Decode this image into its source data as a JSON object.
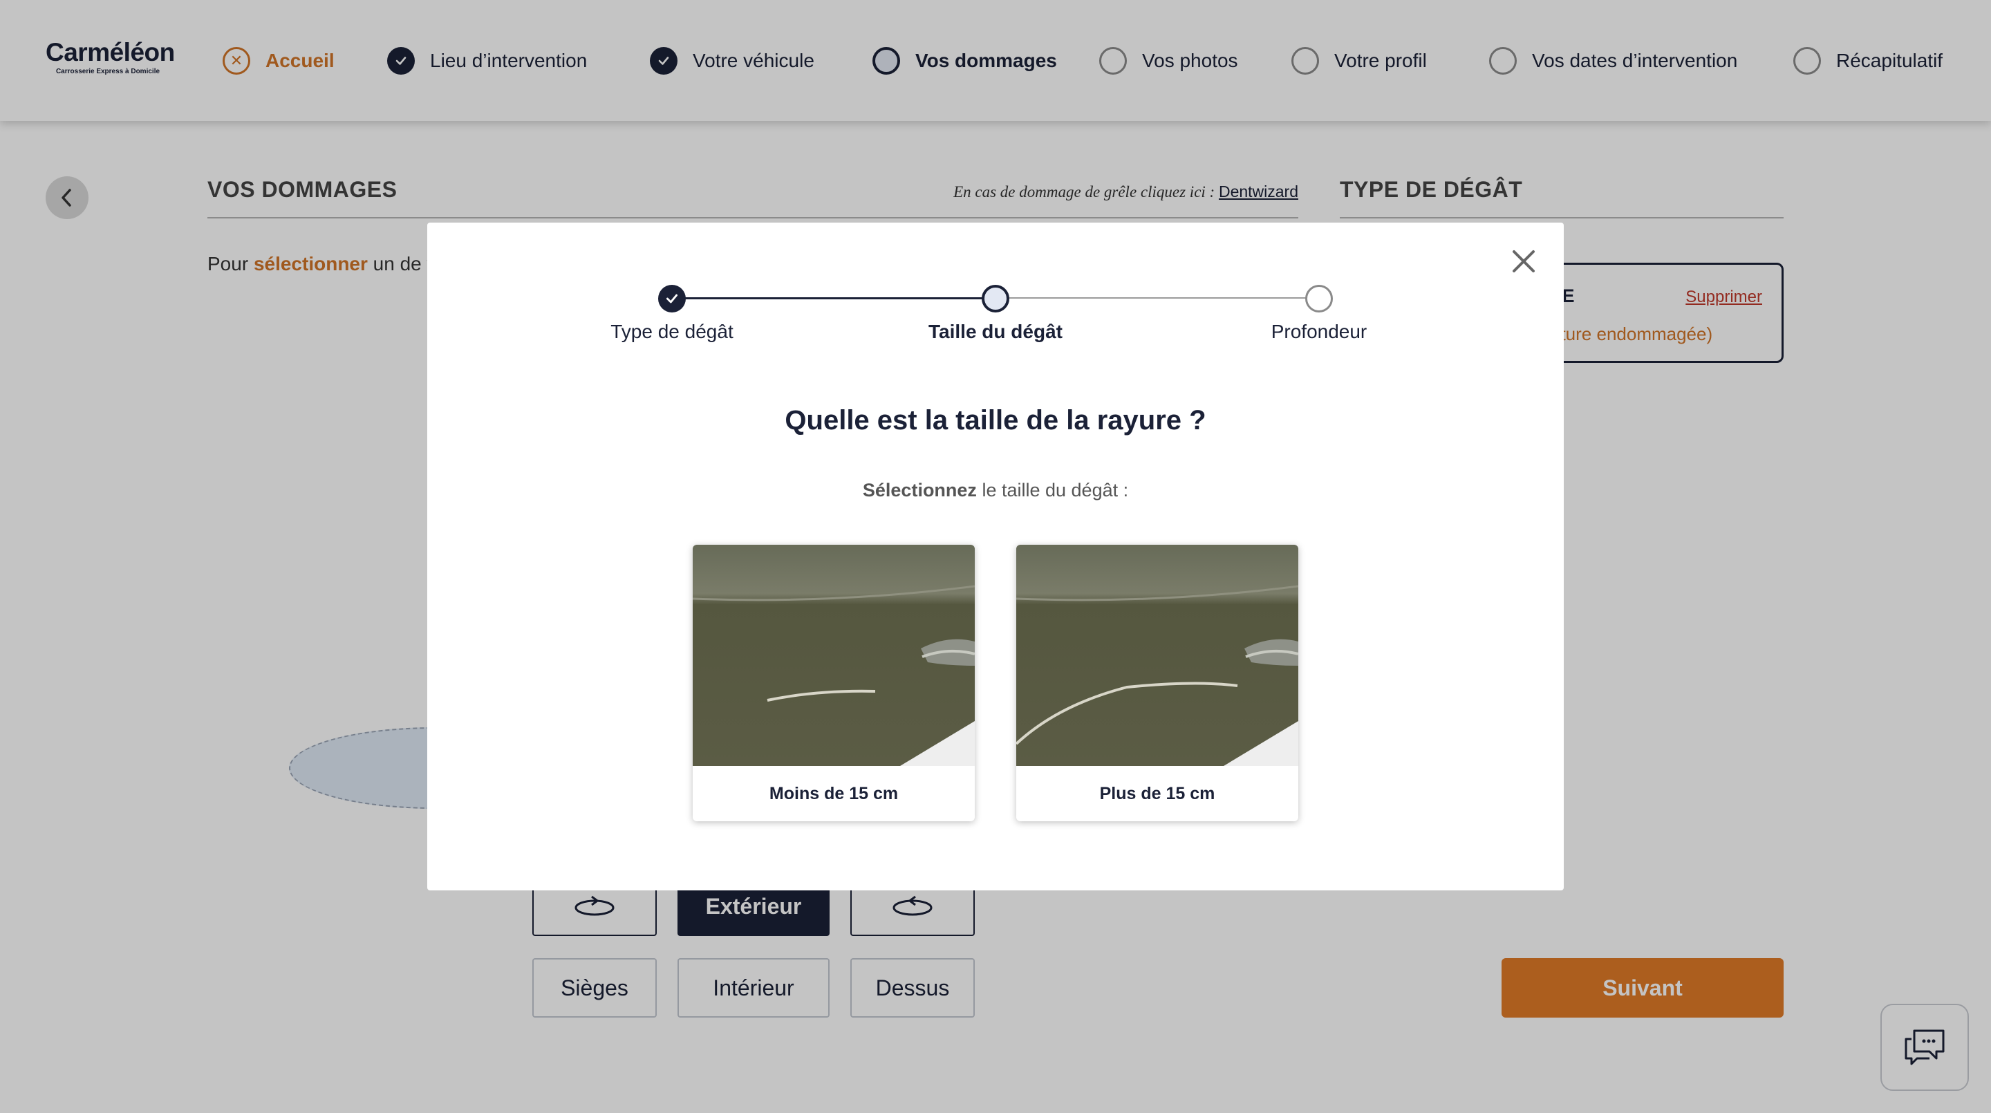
{
  "brand": {
    "name": "Carméléon",
    "tagline": "Carrosserie Express à Domicile"
  },
  "progress_steps": [
    {
      "label": "Accueil",
      "state": "home"
    },
    {
      "label": "Lieu d’intervention",
      "state": "done"
    },
    {
      "label": "Votre véhicule",
      "state": "done"
    },
    {
      "label": "Vos dommages",
      "state": "current"
    },
    {
      "label": "Vos photos",
      "state": "todo"
    },
    {
      "label": "Votre profil",
      "state": "todo"
    },
    {
      "label": "Vos dates d’intervention",
      "state": "todo"
    },
    {
      "label": "Récapitulatif",
      "state": "todo"
    }
  ],
  "page": {
    "damages_title": "VOS DOMMAGES",
    "hail_note": "En cas de dommage de grêle cliquez ici :",
    "hail_link": "Dentwizard",
    "instruction_prefix": "Pour",
    "instruction_highlight": "sélectionner",
    "instruction_suffix": "un de vo",
    "damage_type_title": "TYPE DE DÉGÂT",
    "damage_card": {
      "title": "TE",
      "delete_label": "Supprimer",
      "subtitle": "nture endommagée)"
    }
  },
  "view_buttons": {
    "exterior": "Extérieur",
    "seats": "Sièges",
    "interior": "Intérieur",
    "top": "Dessus"
  },
  "next_label": "Suivant",
  "modal": {
    "steps": [
      {
        "label": "Type de dégât",
        "state": "done"
      },
      {
        "label": "Taille du dégât",
        "state": "current"
      },
      {
        "label": "Profondeur",
        "state": "todo"
      }
    ],
    "question": "Quelle est la taille de la rayure ?",
    "select_bold": "Sélectionnez",
    "select_rest": "le taille du dégât :",
    "options": [
      {
        "label": "Moins de 15 cm"
      },
      {
        "label": "Plus de 15 cm"
      }
    ]
  },
  "colors": {
    "navy": "#1b2137",
    "orange": "#e07b28",
    "accent_text": "#d07428"
  },
  "icons": [
    "close-icon",
    "check-icon",
    "chevron-left-icon",
    "rotate-left-icon",
    "rotate-right-icon",
    "chat-icon"
  ]
}
